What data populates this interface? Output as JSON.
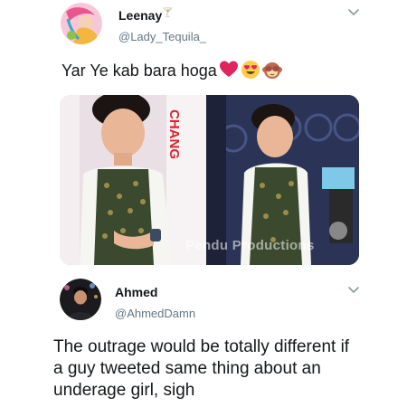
{
  "tweet1": {
    "name": "Leenay",
    "name_emoji": "🍸",
    "handle": "@Lady_Tequila_",
    "text": "Yar Ye kab bara hoga",
    "emojis": [
      "red-heart",
      "heart-eyes-face",
      "see-no-evil-monkey"
    ],
    "media": {
      "watermark": "Pendu Productions",
      "left_backdrop_text": "CHANG"
    }
  },
  "tweet2": {
    "name": "Ahmed",
    "handle": "@AhmedDamn",
    "text": "The outrage would be totally different if a guy tweeted same thing about an underage girl, sigh"
  },
  "icons": {
    "menu": "chevron-down-icon"
  },
  "colors": {
    "text": "#14171a",
    "secondary": "#657786",
    "heart": "#e0245e"
  }
}
